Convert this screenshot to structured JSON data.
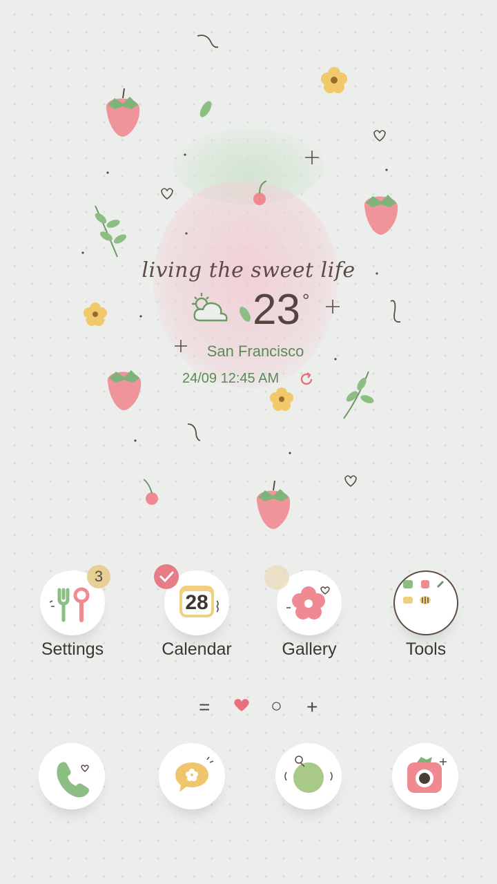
{
  "wallpaper": {
    "tagline": "living the sweet life"
  },
  "weather": {
    "icon": "partly-cloudy-icon",
    "temperature": "23",
    "degree_symbol": "°",
    "city": "San Francisco",
    "datetime": "24/09 12:45 AM",
    "refresh_icon": "refresh-icon"
  },
  "apps": [
    {
      "label": "Settings",
      "icon": "settings-icon",
      "badge": "3"
    },
    {
      "label": "Calendar",
      "icon": "calendar-icon",
      "date": "28"
    },
    {
      "label": "Gallery",
      "icon": "gallery-icon"
    },
    {
      "label": "Tools",
      "icon": "folder-icon"
    }
  ],
  "page_indicator": {
    "items": [
      "menu-icon",
      "heart-icon",
      "circle-icon",
      "plus-icon"
    ],
    "labels": [
      "=",
      "○",
      "+"
    ],
    "active": 1
  },
  "dock": [
    {
      "icon": "phone-icon"
    },
    {
      "icon": "messages-icon"
    },
    {
      "icon": "internet-icon"
    },
    {
      "icon": "camera-icon"
    }
  ],
  "colors": {
    "background": "#eceeec",
    "accent_green": "#5a8a55",
    "accent_pink": "#e86f7e",
    "text_dark": "#3e3532"
  }
}
